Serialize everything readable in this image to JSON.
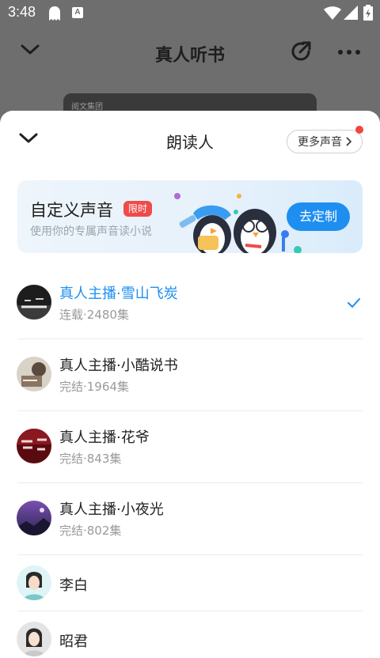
{
  "status_bar": {
    "time": "3:48",
    "icons": [
      "ghost-app-icon",
      "a-app-icon",
      "wifi-icon",
      "signal-icon",
      "battery-icon"
    ]
  },
  "header": {
    "title": "真人听书",
    "icons": [
      "chevron-down-icon",
      "share-icon",
      "more-icon"
    ]
  },
  "cover": {
    "publisher": "阅文集团"
  },
  "sheet": {
    "title": "朗读人",
    "more_voices_label": "更多声音",
    "banner": {
      "title": "自定义声音",
      "badge": "限时",
      "subtitle": "使用你的专属声音读小说",
      "button": "去定制"
    },
    "voices": [
      {
        "name": "真人主播·雪山飞炭",
        "meta": "连载·2480集",
        "selected": true
      },
      {
        "name": "真人主播·小酷说书",
        "meta": "完结·1964集",
        "selected": false
      },
      {
        "name": "真人主播·花爷",
        "meta": "完结·843集",
        "selected": false
      },
      {
        "name": "真人主播·小夜光",
        "meta": "完结·802集",
        "selected": false
      },
      {
        "name": "李白",
        "selected": false
      },
      {
        "name": "昭君",
        "selected": false
      }
    ]
  },
  "colors": {
    "accent": "#1e8ff0",
    "badge": "#ef4b4b",
    "dim_overlay": "#6e6e6e"
  }
}
